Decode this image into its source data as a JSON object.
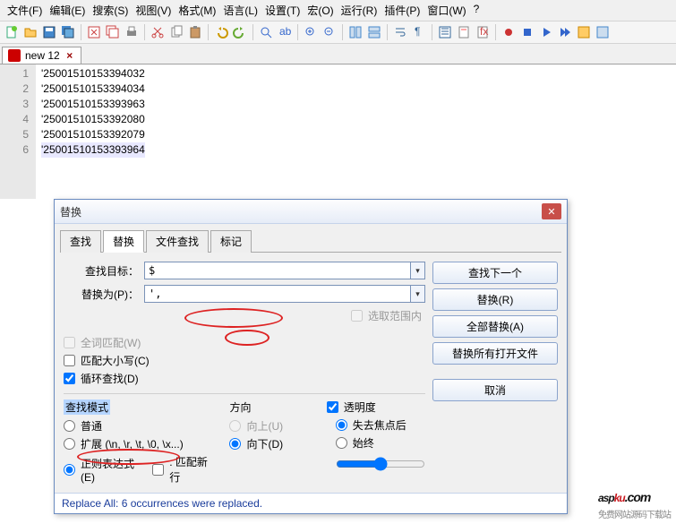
{
  "menu": {
    "items": [
      "文件(F)",
      "编辑(E)",
      "搜索(S)",
      "视图(V)",
      "格式(M)",
      "语言(L)",
      "设置(T)",
      "宏(O)",
      "运行(R)",
      "插件(P)",
      "窗口(W)",
      "?"
    ]
  },
  "filetab": {
    "name": "new 12"
  },
  "code": {
    "lines": [
      "'25001510153394032",
      "'25001510153394034",
      "'25001510153393963",
      "'25001510153392080",
      "'25001510153392079",
      "'25001510153393964"
    ]
  },
  "dialog": {
    "title": "替换",
    "tabs": [
      "查找",
      "替换",
      "文件查找",
      "标记"
    ],
    "active_tab": 1,
    "find_label": "查找目标：",
    "find_value": "$",
    "replace_label": "替换为(P)：",
    "replace_value": "',",
    "opt_in_selection": "选取范围内",
    "opt_whole": "全词匹配(W)",
    "opt_case": "匹配大小写(C)",
    "opt_wrap": "循环查找(D)",
    "btn_findnext": "查找下一个",
    "btn_replace": "替换(R)",
    "btn_replaceall": "全部替换(A)",
    "btn_replaceopen": "替换所有打开文件",
    "btn_cancel": "取消",
    "mode_title": "查找模式",
    "mode_normal": "普通",
    "mode_extended": "扩展 (\\n, \\r, \\t, \\0, \\x...)",
    "mode_regex": "正则表达式(E)",
    "mode_matchnl": ". 匹配新行",
    "dir_title": "方向",
    "dir_up": "向上(U)",
    "dir_down": "向下(D)",
    "trans_title": "透明度",
    "trans_onlose": "失去焦点后",
    "trans_always": "始终",
    "status": "Replace All: 6 occurrences were replaced."
  },
  "logo": {
    "brand_a": "asp",
    "brand_b": "ku",
    "tld": ".com",
    "tagline": "免费网站源码下载站"
  }
}
